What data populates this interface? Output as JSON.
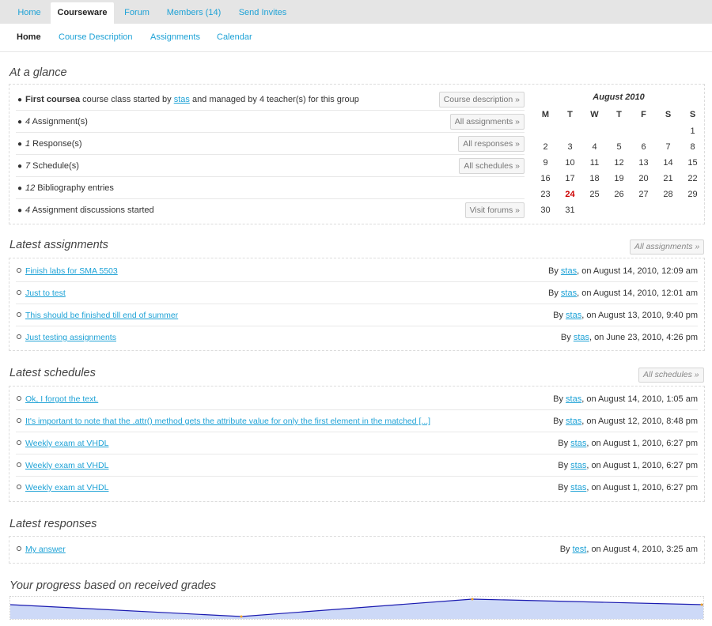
{
  "nav": {
    "tabs": [
      {
        "label": "Home"
      },
      {
        "label": "Courseware"
      },
      {
        "label": "Forum"
      },
      {
        "label": "Members (14)"
      },
      {
        "label": "Send Invites"
      }
    ],
    "subtabs": [
      {
        "label": "Home"
      },
      {
        "label": "Course Description"
      },
      {
        "label": "Assignments"
      },
      {
        "label": "Calendar"
      }
    ]
  },
  "glance": {
    "title": "At a glance",
    "rows": [
      {
        "pre": "",
        "num": "",
        "strong": "First coursea",
        "text": " course class started by ",
        "user": "stas",
        "text2": " and managed by 4 teacher(s) for this group",
        "button": "Course description »"
      },
      {
        "num": "4",
        "text": " Assignment(s)",
        "button": "All assignments »"
      },
      {
        "num": "1",
        "text": " Response(s)",
        "button": "All responses »"
      },
      {
        "num": "7",
        "text": " Schedule(s)",
        "button": "All schedules »"
      },
      {
        "num": "12",
        "text": " Bibliography entries",
        "button": ""
      },
      {
        "num": "4",
        "text": " Assignment discussions started",
        "button": "Visit forums »"
      }
    ]
  },
  "calendar": {
    "month": "August 2010",
    "day_headers": [
      "M",
      "T",
      "W",
      "T",
      "F",
      "S",
      "S"
    ],
    "weeks": [
      [
        "",
        "",
        "",
        "",
        "",
        "",
        "1"
      ],
      [
        "2",
        "3",
        "4",
        "5",
        "6",
        "7",
        "8"
      ],
      [
        "9",
        "10",
        "11",
        "12",
        "13",
        "14",
        "15"
      ],
      [
        "16",
        "17",
        "18",
        "19",
        "20",
        "21",
        "22"
      ],
      [
        "23",
        "24",
        "25",
        "26",
        "27",
        "28",
        "29"
      ],
      [
        "30",
        "31",
        "",
        "",
        "",
        "",
        ""
      ]
    ],
    "today": "24"
  },
  "assignments": {
    "title": "Latest assignments",
    "button": "All assignments »",
    "items": [
      {
        "title": "Finish labs for SMA 5503",
        "by": "By ",
        "user": "stas",
        "date": ", on August 14, 2010, 12:09 am"
      },
      {
        "title": "Just to test",
        "by": "By ",
        "user": "stas",
        "date": ", on August 14, 2010, 12:01 am"
      },
      {
        "title": "This should be finished till end of summer",
        "by": "By ",
        "user": "stas",
        "date": ", on August 13, 2010, 9:40 pm"
      },
      {
        "title": "Just testing assignments",
        "by": "By ",
        "user": "stas",
        "date": ", on June 23, 2010, 4:26 pm"
      }
    ]
  },
  "schedules": {
    "title": "Latest schedules",
    "button": "All schedules »",
    "items": [
      {
        "title": "Ok, I forgot the text.",
        "by": "By ",
        "user": "stas",
        "date": ", on August 14, 2010, 1:05 am"
      },
      {
        "title": "It's important to note that the .attr() method gets the attribute value for only the first element in the matched [...]",
        "by": "By ",
        "user": "stas",
        "date": ", on August 12, 2010, 8:48 pm"
      },
      {
        "title": "Weekly exam at VHDL",
        "by": "By ",
        "user": "stas",
        "date": ", on August 1, 2010, 6:27 pm"
      },
      {
        "title": "Weekly exam at VHDL",
        "by": "By ",
        "user": "stas",
        "date": ", on August 1, 2010, 6:27 pm"
      },
      {
        "title": "Weekly exam at VHDL",
        "by": "By ",
        "user": "stas",
        "date": ", on August 1, 2010, 6:27 pm"
      }
    ]
  },
  "responses": {
    "title": "Latest responses",
    "items": [
      {
        "title": " My answer",
        "by": "By ",
        "user": "test",
        "date": ", on August 4, 2010, 3:25 am"
      }
    ]
  },
  "progress": {
    "title": "Your progress based on received grades",
    "line_color": "#1a1ab0",
    "fill_color": "#cdd9f7",
    "point_color": "#f5a623"
  }
}
